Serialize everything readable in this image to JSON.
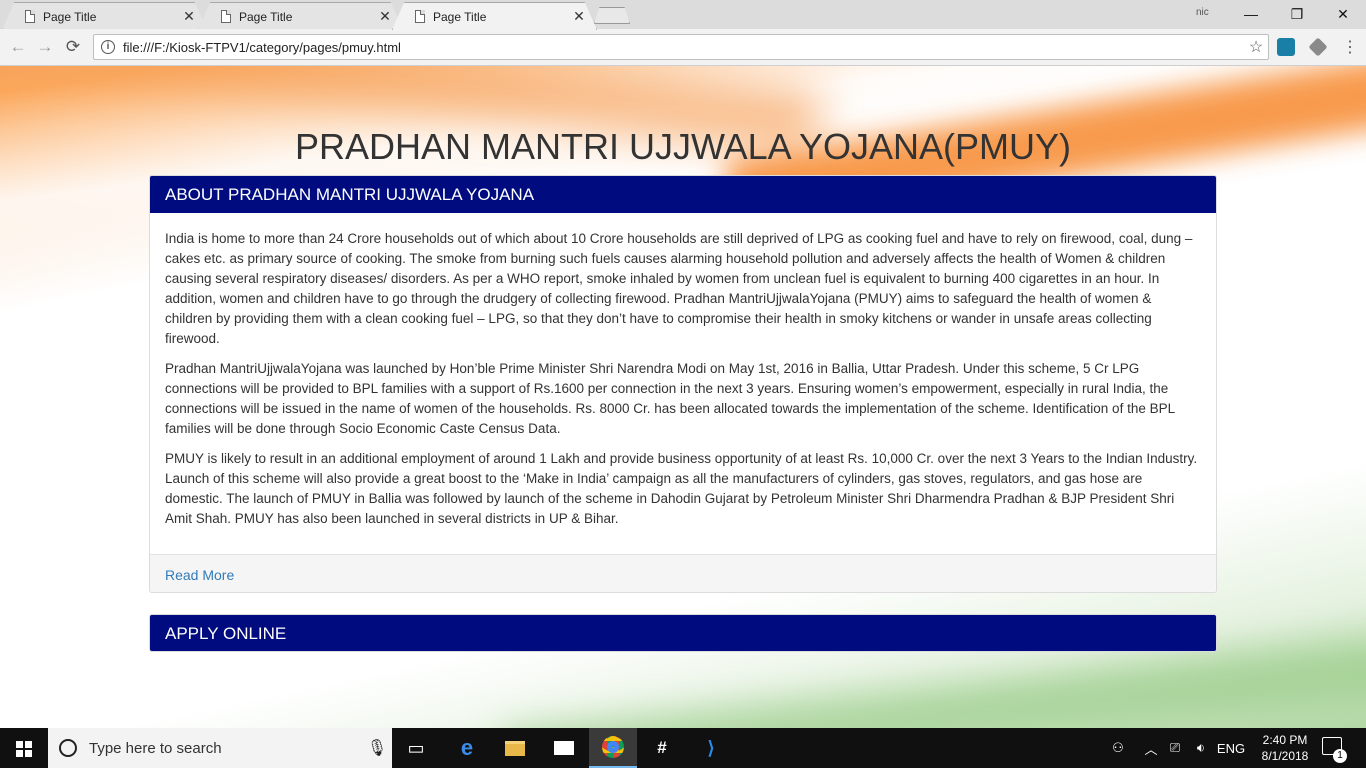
{
  "browser": {
    "tabs": [
      {
        "title": "Page Title",
        "close": "✕"
      },
      {
        "title": "Page Title",
        "close": "✕"
      },
      {
        "title": "Page Title",
        "close": "✕"
      }
    ],
    "profile_label": "nic",
    "window_controls": {
      "minimize": "—",
      "maximize": "❐",
      "close": "✕"
    },
    "nav": {
      "back": "←",
      "forward": "→",
      "reload": "⟳"
    },
    "url": "file:///F:/Kiosk-FTPV1/category/pages/pmuy.html",
    "star": "☆",
    "menu": "⋮"
  },
  "page": {
    "title": "PRADHAN MANTRI UJJWALA YOJANA(PMUY)",
    "about_panel": {
      "heading": "ABOUT PRADHAN MANTRI UJJWALA YOJANA",
      "paragraphs": [
        "India is home to more than 24 Crore households out of which about 10 Crore households are still deprived of LPG as cooking fuel and have to rely on firewood, coal, dung – cakes etc. as primary source of cooking. The smoke from burning such fuels causes alarming household pollution and adversely affects the health of Women & children causing several respiratory diseases/ disorders. As per a WHO report, smoke inhaled by women from unclean fuel is equivalent to burning 400 cigarettes in an hour. In addition, women and children have to go through the drudgery of collecting firewood. Pradhan MantriUjjwalaYojana (PMUY) aims to safeguard the health of women & children by providing them with a clean cooking fuel – LPG, so that they don’t have to compromise their health in smoky kitchens or wander in unsafe areas collecting firewood.",
        "Pradhan MantriUjjwalaYojana was launched by Hon’ble Prime Minister Shri Narendra Modi on May 1st, 2016 in Ballia, Uttar Pradesh. Under this scheme, 5 Cr LPG connections will be provided to BPL families with a support of Rs.1600 per connection in the next 3 years. Ensuring women’s empowerment, especially in rural India, the connections will be issued in the name of women of the households. Rs. 8000 Cr. has been allocated towards the implementation of the scheme. Identification of the BPL families will be done through Socio Economic Caste Census Data.",
        "PMUY is likely to result in an additional employment of around 1 Lakh and provide business opportunity of at least Rs. 10,000 Cr. over the next 3 Years to the Indian Industry. Launch of this scheme will also provide a great boost to the ‘Make in India’ campaign as all the manufacturers of cylinders, gas stoves, regulators, and gas hose are domestic. The launch of PMUY in Ballia was followed by launch of the scheme in Dahodin Gujarat by Petroleum Minister Shri Dharmendra Pradhan & BJP President Shri Amit Shah. PMUY has also been launched in several districts in UP & Bihar."
      ],
      "read_more": "Read More"
    },
    "apply_panel": {
      "heading": "APPLY ONLINE"
    }
  },
  "taskbar": {
    "search_placeholder": "Type here to search",
    "apps": [
      "task-view",
      "edge",
      "file-explorer",
      "mail",
      "chrome",
      "slack",
      "vscode"
    ],
    "tray": {
      "language": "ENG",
      "time": "2:40 PM",
      "date": "8/1/2018",
      "notification_count": "1"
    }
  },
  "colors": {
    "panel_heading_bg": "#000b80",
    "link": "#337ab7",
    "saffron": "#f7892e",
    "green": "#8dc67b"
  }
}
